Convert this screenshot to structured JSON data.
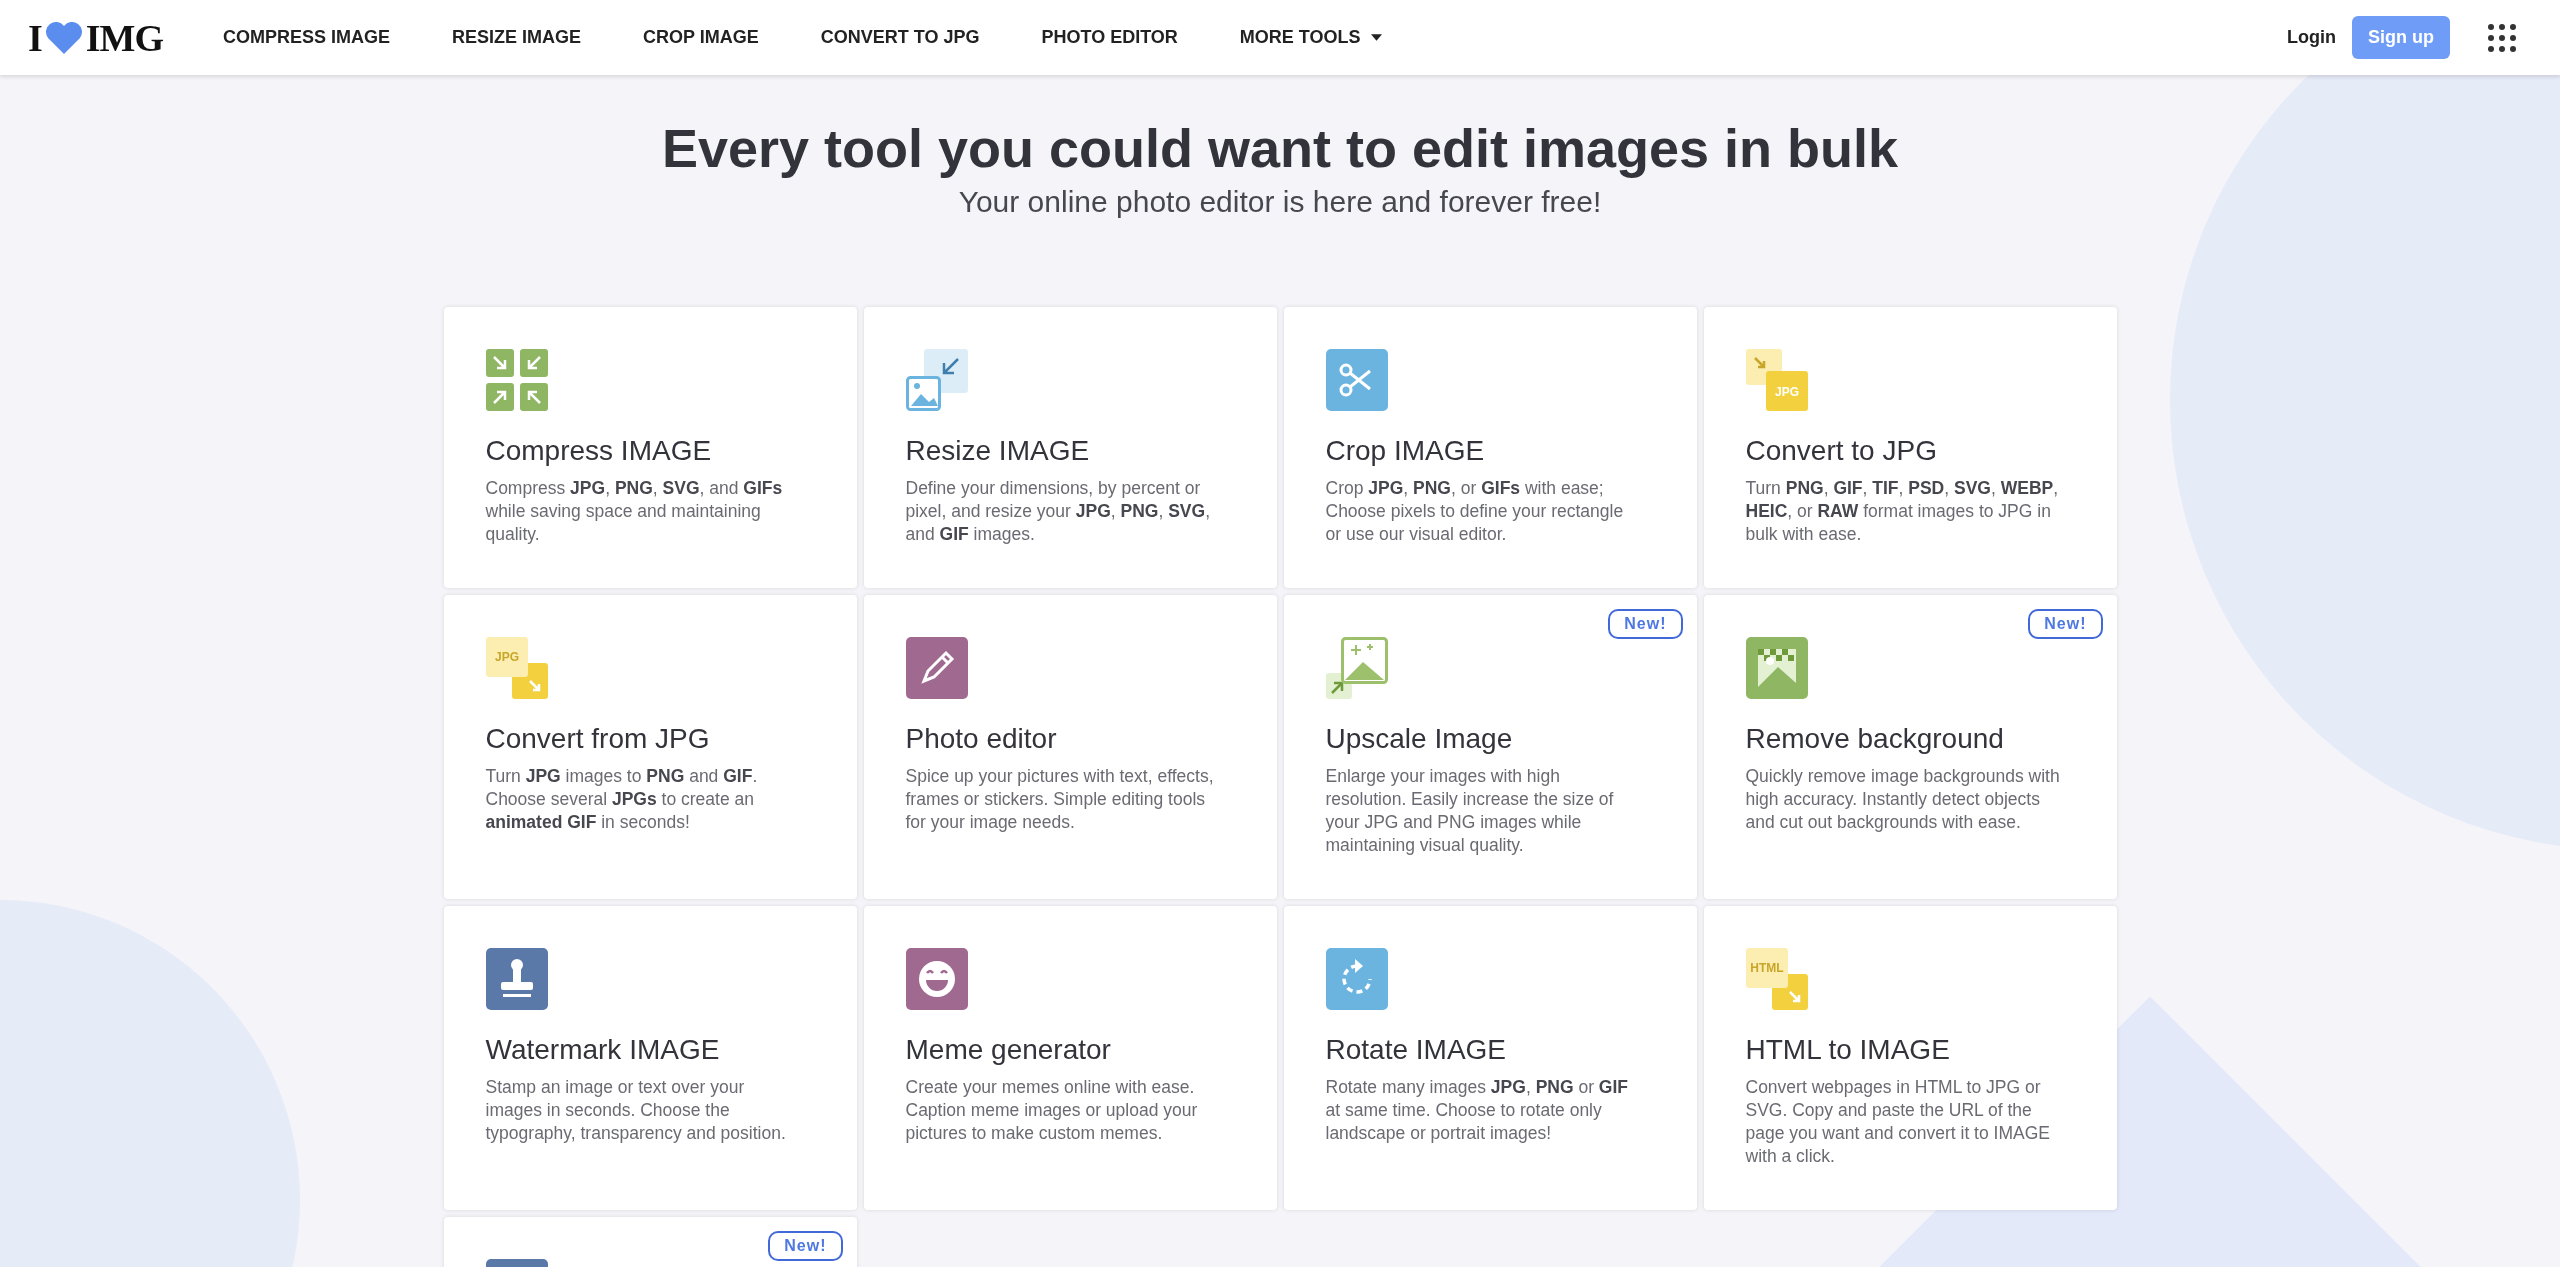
{
  "header": {
    "logo": {
      "left": "I",
      "right": "IMG"
    },
    "nav": [
      {
        "label": "COMPRESS IMAGE"
      },
      {
        "label": "RESIZE IMAGE"
      },
      {
        "label": "CROP IMAGE"
      },
      {
        "label": "CONVERT TO JPG"
      },
      {
        "label": "PHOTO EDITOR"
      },
      {
        "label": "MORE TOOLS",
        "dropdown": true
      }
    ],
    "login": "Login",
    "signup": "Sign up"
  },
  "hero": {
    "title": "Every tool you could want to edit images in bulk",
    "subtitle": "Your online photo editor is here and forever free!"
  },
  "tools": [
    {
      "kind": "compress",
      "title": "Compress IMAGE",
      "description": "Compress **JPG**, **PNG**, **SVG**, and **GIFs** while saving space and maintaining quality."
    },
    {
      "kind": "resize",
      "title": "Resize IMAGE",
      "description": "Define your dimensions, by percent or pixel, and resize your **JPG**, **PNG**, **SVG**, and **GIF** images."
    },
    {
      "kind": "crop",
      "title": "Crop IMAGE",
      "description": "Crop **JPG**, **PNG**, or **GIFs** with ease; Choose pixels to define your rectangle or use our visual editor."
    },
    {
      "kind": "to-format",
      "icon_label": "JPG",
      "title": "Convert to JPG",
      "description": "Turn **PNG**, **GIF**, **TIF**, **PSD**, **SVG**, **WEBP**, **HEIC**, or **RAW** format images to JPG in bulk with ease."
    },
    {
      "kind": "from-format",
      "icon_label": "JPG",
      "title": "Convert from JPG",
      "description": "Turn **JPG** images to **PNG** and **GIF**. Choose several **JPGs** to create an **animated GIF** in seconds!"
    },
    {
      "kind": "editor",
      "title": "Photo editor",
      "description": "Spice up your pictures with text, effects, frames or stickers. Simple editing tools for your image needs."
    },
    {
      "kind": "upscale",
      "badge": "New!",
      "title": "Upscale Image",
      "description": "Enlarge your images with high resolution. Easily increase the size of your JPG and PNG images while maintaining visual quality."
    },
    {
      "kind": "remove-bg",
      "badge": "New!",
      "title": "Remove background",
      "description": "Quickly remove image backgrounds with high accuracy. Instantly detect objects and cut out backgrounds with ease."
    },
    {
      "kind": "watermark",
      "title": "Watermark IMAGE",
      "description": "Stamp an image or text over your images in seconds. Choose the typography, transparency and position."
    },
    {
      "kind": "meme",
      "title": "Meme generator",
      "description": "Create your memes online with ease. Caption meme images or upload your pictures to make custom memes."
    },
    {
      "kind": "rotate",
      "title": "Rotate IMAGE",
      "description": "Rotate many images **JPG**, **PNG** or **GIF** at same time. Choose to rotate only landscape or portrait images!"
    },
    {
      "kind": "from-format",
      "icon_label": "HTML",
      "title": "HTML to IMAGE",
      "description": "Convert webpages in HTML to JPG or SVG. Copy and paste the URL of the page you want and convert it to IMAGE with a click."
    },
    {
      "kind": "partial",
      "badge": "New!"
    }
  ]
}
